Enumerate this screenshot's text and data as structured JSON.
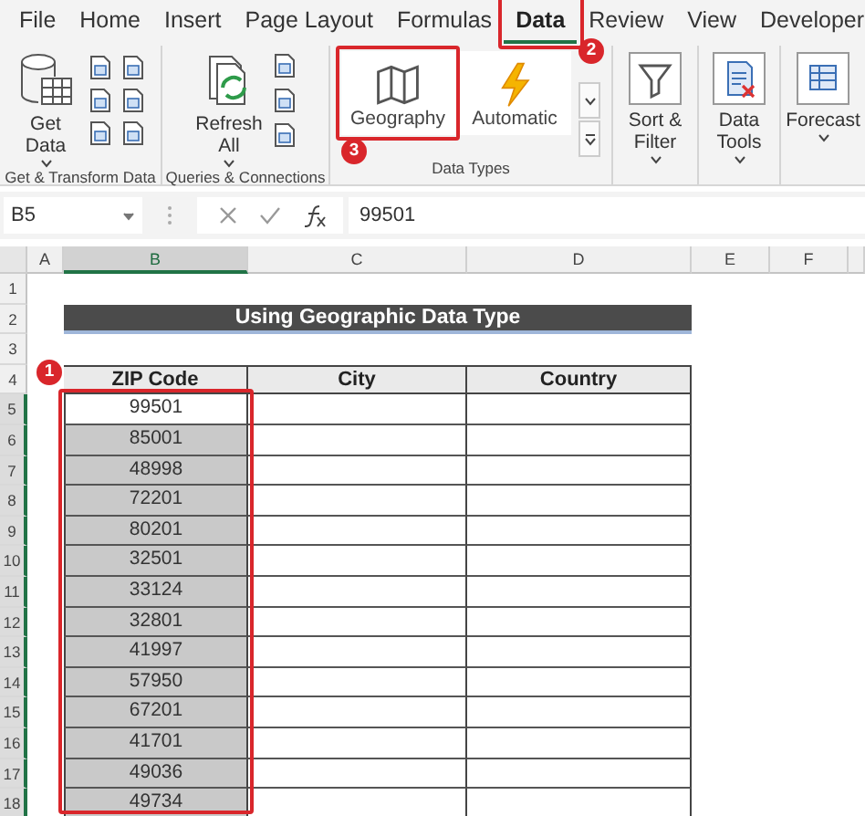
{
  "tabs": [
    {
      "label": "File",
      "selected": false
    },
    {
      "label": "Home",
      "selected": false
    },
    {
      "label": "Insert",
      "selected": false
    },
    {
      "label": "Page Layout",
      "selected": false
    },
    {
      "label": "Formulas",
      "selected": false
    },
    {
      "label": "Data",
      "selected": true,
      "callout": "2"
    },
    {
      "label": "Review",
      "selected": false
    },
    {
      "label": "View",
      "selected": false
    },
    {
      "label": "Developer",
      "selected": false
    }
  ],
  "ribbon_groups": [
    {
      "label": "Get & Transform Data",
      "buttons": [
        {
          "kind": "large",
          "label": "Get Data",
          "dropdown": true
        },
        {
          "kind": "icon-grid"
        }
      ]
    },
    {
      "label": "Queries & Connections",
      "buttons": [
        {
          "kind": "large",
          "label": "Refresh All",
          "dropdown": true
        },
        {
          "kind": "icon-column"
        }
      ]
    },
    {
      "label": "Data Types",
      "buttons": [
        {
          "kind": "gallery",
          "label": "Geography",
          "callout": "3"
        },
        {
          "kind": "gallery",
          "label": "Automatic"
        },
        {
          "kind": "gallery-scroll"
        }
      ]
    },
    {
      "buttons": [
        {
          "kind": "large",
          "label": "Sort & Filter",
          "dropdown": true
        }
      ]
    },
    {
      "buttons": [
        {
          "kind": "large",
          "label": "Data Tools",
          "dropdown": true
        }
      ]
    },
    {
      "buttons": [
        {
          "kind": "large",
          "label": "Forecast",
          "dropdown": true
        }
      ]
    }
  ],
  "formula_bar": {
    "name_box": "B5",
    "formula": "99501"
  },
  "sheet": {
    "columns": [
      {
        "label": "A",
        "selected": false
      },
      {
        "label": "B",
        "selected": true
      },
      {
        "label": "C",
        "selected": false
      },
      {
        "label": "D",
        "selected": false
      },
      {
        "label": "E",
        "selected": false
      },
      {
        "label": "F",
        "selected": false
      }
    ],
    "rows": [
      {
        "label": "1",
        "selected": false
      },
      {
        "label": "2",
        "selected": false
      },
      {
        "label": "3",
        "selected": false
      },
      {
        "label": "4",
        "selected": false
      },
      {
        "label": "5",
        "selected": true
      },
      {
        "label": "6",
        "selected": true
      },
      {
        "label": "7",
        "selected": true
      },
      {
        "label": "8",
        "selected": true
      },
      {
        "label": "9",
        "selected": true
      },
      {
        "label": "10",
        "selected": true
      },
      {
        "label": "11",
        "selected": true
      },
      {
        "label": "12",
        "selected": true
      },
      {
        "label": "13",
        "selected": true
      },
      {
        "label": "14",
        "selected": true
      },
      {
        "label": "15",
        "selected": true
      },
      {
        "label": "16",
        "selected": true
      },
      {
        "label": "17",
        "selected": true
      },
      {
        "label": "18",
        "selected": true
      }
    ],
    "title": "Using Geographic Data Type",
    "table": {
      "columns": [
        "ZIP Code",
        "City",
        "Country"
      ],
      "callout": "1",
      "zip_codes": [
        {
          "value": "99501",
          "active": true
        },
        {
          "value": "85001",
          "active": false
        },
        {
          "value": "48998",
          "active": false
        },
        {
          "value": "72201",
          "active": false
        },
        {
          "value": "80201",
          "active": false
        },
        {
          "value": "32501",
          "active": false
        },
        {
          "value": "33124",
          "active": false
        },
        {
          "value": "32801",
          "active": false
        },
        {
          "value": "41997",
          "active": false
        },
        {
          "value": "57950",
          "active": false
        },
        {
          "value": "67201",
          "active": false
        },
        {
          "value": "41701",
          "active": false
        },
        {
          "value": "49036",
          "active": false
        },
        {
          "value": "49734",
          "active": false
        }
      ]
    }
  }
}
